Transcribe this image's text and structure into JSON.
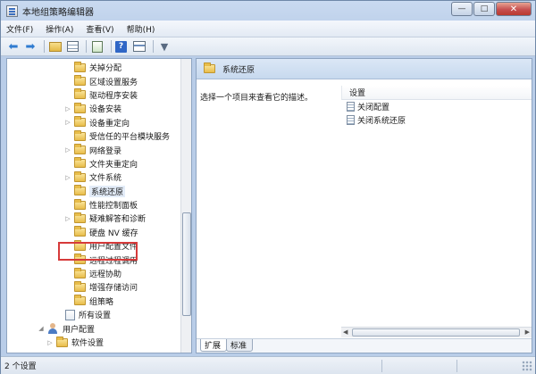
{
  "window": {
    "title": "本地组策略编辑器",
    "controls": {
      "minimize": "—",
      "maximize": "□",
      "close": "✕"
    }
  },
  "menu": [
    "文件(F)",
    "操作(A)",
    "查看(V)",
    "帮助(H)"
  ],
  "toolbar": {
    "icons": [
      "back-arrow-icon",
      "forward-arrow-icon",
      "folder-up-icon",
      "show-tree-icon",
      "export-list-icon",
      "help-icon",
      "properties-icon",
      "filter-icon"
    ]
  },
  "tree": [
    {
      "label": "关掉分配",
      "indent": 1,
      "expander": ""
    },
    {
      "label": "区域设置服务",
      "indent": 1,
      "expander": ""
    },
    {
      "label": "驱动程序安装",
      "indent": 1,
      "expander": ""
    },
    {
      "label": "设备安装",
      "indent": 1,
      "expander": "▷"
    },
    {
      "label": "设备重定向",
      "indent": 1,
      "expander": "▷"
    },
    {
      "label": "受信任的平台模块服务",
      "indent": 1,
      "expander": ""
    },
    {
      "label": "网络登录",
      "indent": 1,
      "expander": "▷"
    },
    {
      "label": "文件夹重定向",
      "indent": 1,
      "expander": ""
    },
    {
      "label": "文件系统",
      "indent": 1,
      "expander": "▷"
    },
    {
      "label": "系统还原",
      "indent": 1,
      "expander": "",
      "selected": true
    },
    {
      "label": "性能控制面板",
      "indent": 1,
      "expander": ""
    },
    {
      "label": "疑难解答和诊断",
      "indent": 1,
      "expander": "▷"
    },
    {
      "label": "硬盘 NV 缓存",
      "indent": 1,
      "expander": ""
    },
    {
      "label": "用户配置文件",
      "indent": 1,
      "expander": ""
    },
    {
      "label": "远程过程调用",
      "indent": 1,
      "expander": ""
    },
    {
      "label": "远程协助",
      "indent": 1,
      "expander": ""
    },
    {
      "label": "增强存储访问",
      "indent": 1,
      "expander": ""
    },
    {
      "label": "组策略",
      "indent": 1,
      "expander": ""
    },
    {
      "label": "所有设置",
      "indent": 0,
      "expander": "",
      "icon": "settings"
    },
    {
      "label": "用户配置",
      "indent": -2,
      "expander": "◢",
      "icon": "user"
    },
    {
      "label": "软件设置",
      "indent": -1,
      "expander": "▷"
    }
  ],
  "content": {
    "title": "系统还原",
    "description": "选择一个项目来查看它的描述。",
    "column_header": "设置",
    "items": [
      "关闭配置",
      "关闭系统还原"
    ]
  },
  "tabs": [
    "扩展",
    "标准"
  ],
  "status": {
    "text": "2 个设置"
  }
}
